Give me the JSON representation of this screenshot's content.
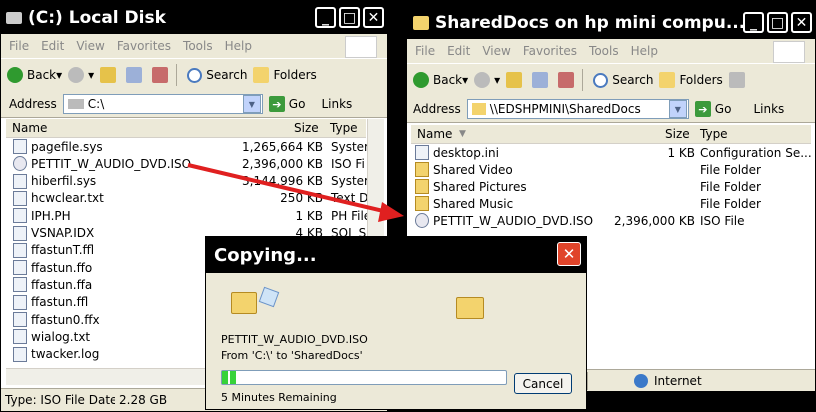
{
  "left_window": {
    "title": "(C:) Local Disk",
    "menu": [
      "File",
      "Edit",
      "View",
      "Favorites",
      "Tools",
      "Help"
    ],
    "toolbar": {
      "back": "Back",
      "search": "Search",
      "folders": "Folders"
    },
    "address_label": "Address",
    "address": "C:\\",
    "go": "Go",
    "links": "Links",
    "headers": {
      "name": "Name",
      "size": "Size",
      "type": "Type"
    },
    "files": [
      {
        "name": "pagefile.sys",
        "size": "1,265,664 KB",
        "type": "System"
      },
      {
        "name": "PETTIT_W_AUDIO_DVD.ISO",
        "size": "2,396,000 KB",
        "type": "ISO Fi"
      },
      {
        "name": "hiberfil.sys",
        "size": "3,144,996 KB",
        "type": "System"
      },
      {
        "name": "hcwclear.txt",
        "size": "250 KB",
        "type": "Text D"
      },
      {
        "name": "IPH.PH",
        "size": "1 KB",
        "type": "PH File"
      },
      {
        "name": "VSNAP.IDX",
        "size": "4 KB",
        "type": "SOL S"
      },
      {
        "name": "ffastunT.ffl",
        "size": "",
        "type": ""
      },
      {
        "name": "ffastun.ffo",
        "size": "",
        "type": ""
      },
      {
        "name": "ffastun.ffa",
        "size": "",
        "type": ""
      },
      {
        "name": "ffastun.ffl",
        "size": "",
        "type": ""
      },
      {
        "name": "ffastun0.ffx",
        "size": "",
        "type": ""
      },
      {
        "name": "wialog.txt",
        "size": "",
        "type": ""
      },
      {
        "name": "twacker.log",
        "size": "",
        "type": ""
      }
    ],
    "status": {
      "type": "Type: ISO File Date",
      "size": "2.28 GB"
    }
  },
  "right_window": {
    "title": "SharedDocs on hp mini compu...",
    "menu": [
      "File",
      "Edit",
      "View",
      "Favorites",
      "Tools",
      "Help"
    ],
    "toolbar": {
      "back": "Back",
      "search": "Search",
      "folders": "Folders"
    },
    "address_label": "Address",
    "address": "\\\\EDSHPMINI\\SharedDocs",
    "go": "Go",
    "links": "Links",
    "headers": {
      "name": "Name",
      "size": "Size",
      "type": "Type"
    },
    "files": [
      {
        "name": "desktop.ini",
        "size": "1 KB",
        "type": "Configuration Se...",
        "icon": "file"
      },
      {
        "name": "Shared Video",
        "size": "",
        "type": "File Folder",
        "icon": "folder"
      },
      {
        "name": "Shared Pictures",
        "size": "",
        "type": "File Folder",
        "icon": "folder"
      },
      {
        "name": "Shared Music",
        "size": "",
        "type": "File Folder",
        "icon": "folder"
      },
      {
        "name": "PETTIT_W_AUDIO_DVD.ISO",
        "size": "2,396,000 KB",
        "type": "ISO File",
        "icon": "disc"
      }
    ],
    "status": {
      "zone": "Internet"
    }
  },
  "dialog": {
    "title": "Copying...",
    "file": "PETTIT_W_AUDIO_DVD.ISO",
    "from": "From 'C:\\' to 'SharedDocs'",
    "remaining": "5 Minutes Remaining",
    "cancel": "Cancel",
    "progress": 0.05
  },
  "colors": {
    "arrow": "#e02020",
    "titlebar": "#000000",
    "progress": "#37d23a"
  }
}
